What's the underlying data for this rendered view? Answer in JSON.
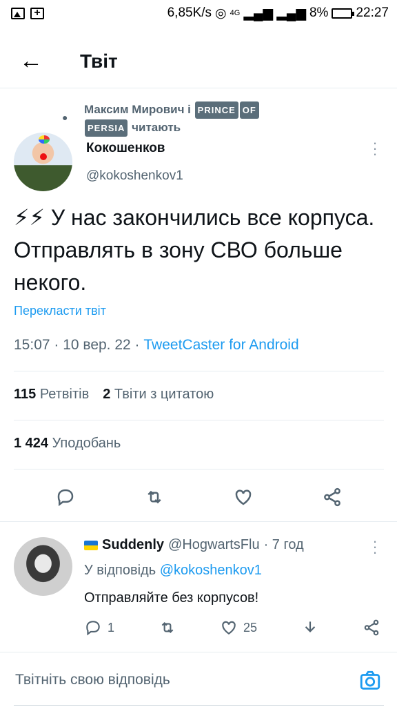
{
  "status_bar": {
    "speed": "6,85K/s",
    "network": "4G",
    "battery": "8%",
    "time": "22:27"
  },
  "header": {
    "title": "Твіт"
  },
  "tweet": {
    "social_context": {
      "names": "Максим Мирович і",
      "badge1": "PRINCE",
      "badge2": "OF",
      "badge3": "PERSIA",
      "suffix": "читають"
    },
    "author_name": "Кокошенков",
    "author_handle": "@kokoshenkov1",
    "text": "⚡⚡ У нас закончились все корпуса. Отправлять в зону СВО больше некого.",
    "translate_label": "Перекласти твіт",
    "time": "15:07 · 10 вер. 22 · ",
    "source": "TweetCaster for Android",
    "retweets_count": "115",
    "retweets_label": "Ретвітів",
    "quotes_count": "2",
    "quotes_label": "Твіти з цитатою",
    "likes_count": "1 424",
    "likes_label": "Уподобань"
  },
  "reply": {
    "name": "Suddenly",
    "handle": "@HogwartsFlu",
    "time": "· 7 год",
    "replying_label": "У відповідь",
    "replying_to": "@kokoshenkov1",
    "text": "Отправляйте без корпусов!",
    "reply_count": "1",
    "like_count": "25"
  },
  "compose": {
    "placeholder": "Твітніть свою відповідь"
  },
  "colors": {
    "accent": "#1d9bf0",
    "muted": "#536471",
    "text": "#0f1419"
  },
  "icons": [
    "back-arrow-icon",
    "reply-icon",
    "retweet-icon",
    "like-icon",
    "share-icon",
    "more-icon",
    "camera-icon"
  ]
}
